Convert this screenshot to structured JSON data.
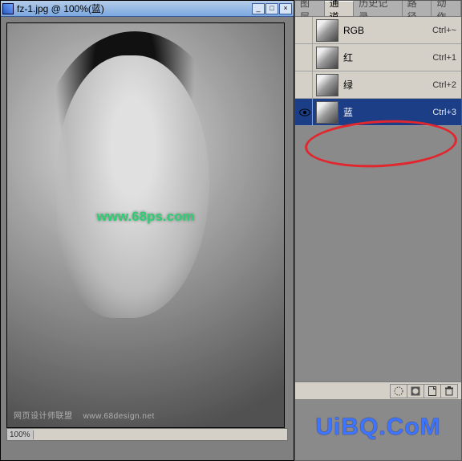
{
  "document": {
    "filename": "fz-1.jpg",
    "zoom": "100%",
    "active_channel_label": "蓝",
    "title": "fz-1.jpg @ 100%(蓝)",
    "watermark_center": "www.68ps.com",
    "watermark_bottom_text": "网页设计师联盟",
    "watermark_bottom_url": "www.68design.net",
    "statusbar_info": "100%"
  },
  "window_controls": {
    "minimize": "_",
    "maximize": "□",
    "close": "×"
  },
  "panel": {
    "tabs": [
      {
        "label": "图层",
        "active": false
      },
      {
        "label": "通道",
        "active": true
      },
      {
        "label": "历史记录",
        "active": false
      },
      {
        "label": "路径",
        "active": false
      },
      {
        "label": "动作",
        "active": false
      }
    ],
    "channels": [
      {
        "name": "RGB",
        "shortcut": "Ctrl+~",
        "visible": false,
        "selected": false
      },
      {
        "name": "红",
        "shortcut": "Ctrl+1",
        "visible": false,
        "selected": false
      },
      {
        "name": "绿",
        "shortcut": "Ctrl+2",
        "visible": false,
        "selected": false
      },
      {
        "name": "蓝",
        "shortcut": "Ctrl+3",
        "visible": true,
        "selected": true
      }
    ],
    "bottom_icons": {
      "load_selection": "load-channel-as-selection-icon",
      "save_selection": "save-selection-as-channel-icon",
      "new_channel": "new-channel-icon",
      "delete_channel": "trash-icon"
    }
  },
  "brand_watermark": "UiBQ.CoM"
}
